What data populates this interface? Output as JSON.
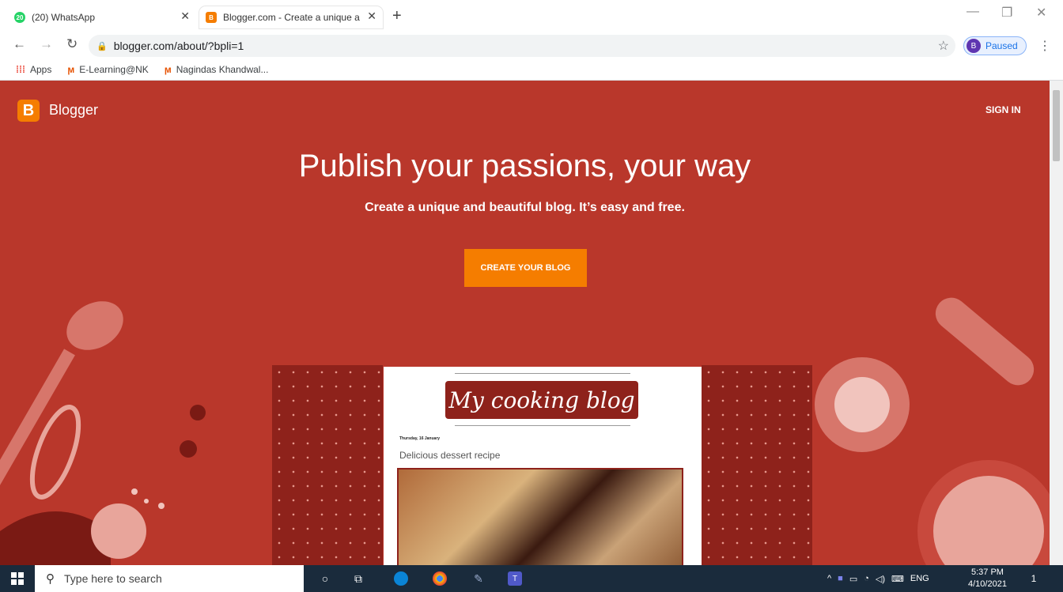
{
  "browser": {
    "tabs": [
      {
        "title": "(20) WhatsApp",
        "badge": "20"
      },
      {
        "title": "Blogger.com - Create a unique a",
        "badge": "B"
      }
    ],
    "url": "blogger.com/about/?bpli=1",
    "profile_initial": "B",
    "profile_status": "Paused",
    "bookmarks": [
      "Apps",
      "E-Learning@NK",
      "Nagindas Khandwal..."
    ]
  },
  "page": {
    "brand": "Blogger",
    "sign_in": "SIGN IN",
    "headline": "Publish your passions, your way",
    "subheadline": "Create a unique and beautiful blog. It’s easy and free.",
    "cta": "CREATE YOUR BLOG",
    "mockup": {
      "blog_title": "My cooking blog",
      "post_date": "Thursday, 16 January",
      "post_title": "Delicious dessert recipe"
    },
    "colors": {
      "background": "#b9372b",
      "accent": "#f57d00",
      "dark": "#8e221b"
    }
  },
  "taskbar": {
    "search_placeholder": "Type here to search",
    "language": "ENG",
    "time": "5:37 PM",
    "date": "4/10/2021",
    "notification_count": "1"
  }
}
